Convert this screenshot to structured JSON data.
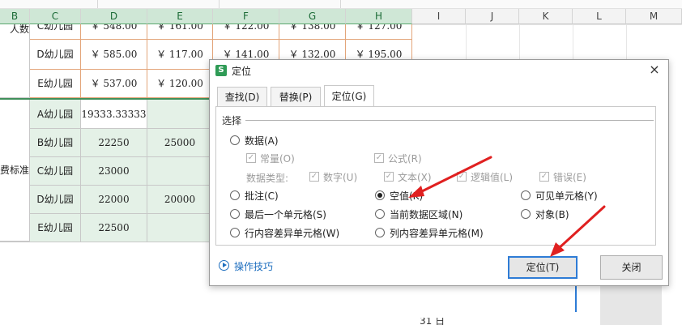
{
  "sheet": {
    "columns": [
      "B",
      "C",
      "D",
      "E",
      "F",
      "G",
      "H",
      "I",
      "J",
      "K",
      "L",
      "M"
    ],
    "selected_columns": [
      "B",
      "C",
      "D",
      "E",
      "F",
      "G",
      "H"
    ],
    "row_labels_partial": [
      "人数",
      "费标准"
    ],
    "rows_top": [
      {
        "c": "C幼儿园",
        "d": "￥ 548.00",
        "e": "￥ 161.00",
        "f": "￥ 122.00",
        "g": "￥ 138.00",
        "h": "￥ 127.00"
      },
      {
        "c": "D幼儿园",
        "d": "￥ 585.00",
        "e": "￥ 117.00",
        "f": "￥ 141.00",
        "g": "￥ 132.00",
        "h": "￥ 195.00"
      },
      {
        "c": "E幼儿园",
        "d": "￥ 537.00",
        "e": "￥ 120.00"
      }
    ],
    "rows_bottom": [
      {
        "c": "A幼儿园",
        "d": "19333.33333",
        "e": ""
      },
      {
        "c": "B幼儿园",
        "d": "22250",
        "e": "25000"
      },
      {
        "c": "C幼儿园",
        "d": "23000",
        "e": ""
      },
      {
        "c": "D幼儿园",
        "d": "22000",
        "e": "20000"
      },
      {
        "c": "E幼儿园",
        "d": "22500",
        "e": ""
      }
    ],
    "bottom_partial_text": "31 日"
  },
  "dialog": {
    "icon_letter": "S",
    "title": "定位",
    "close_symbol": "×",
    "tabs": [
      {
        "label": "查找(D)",
        "active": false
      },
      {
        "label": "替换(P)",
        "active": false
      },
      {
        "label": "定位(G)",
        "active": true
      }
    ],
    "group_label": "选择",
    "options": {
      "data": {
        "label": "数据(A)",
        "checked": false
      },
      "comment": {
        "label": "批注(C)",
        "checked": false
      },
      "blank": {
        "label": "空值(K)",
        "checked": true
      },
      "visible": {
        "label": "可见单元格(Y)",
        "checked": false
      },
      "last_cell": {
        "label": "最后一个单元格(S)",
        "checked": false
      },
      "current_region": {
        "label": "当前数据区域(N)",
        "checked": false
      },
      "objects": {
        "label": "对象(B)",
        "checked": false
      },
      "row_diff": {
        "label": "行内容差异单元格(W)",
        "checked": false
      },
      "col_diff": {
        "label": "列内容差异单元格(M)",
        "checked": false
      }
    },
    "sub_options": {
      "constant": {
        "label": "常量(O)",
        "checked": true
      },
      "formula": {
        "label": "公式(R)",
        "checked": true
      },
      "data_type_label": "数据类型:",
      "number": {
        "label": "数字(U)",
        "checked": true
      },
      "text": {
        "label": "文本(X)",
        "checked": true
      },
      "logical": {
        "label": "逻辑值(L)",
        "checked": true
      },
      "error": {
        "label": "错误(E)",
        "checked": true
      }
    },
    "tips_label": "操作技巧",
    "locate_button": "定位(T)",
    "close_button": "关闭"
  },
  "colors": {
    "accent": "#2e7cd6",
    "header_green": "#cfe7d6",
    "arrow_red": "#e02020",
    "brand_green": "#2f9b56"
  }
}
